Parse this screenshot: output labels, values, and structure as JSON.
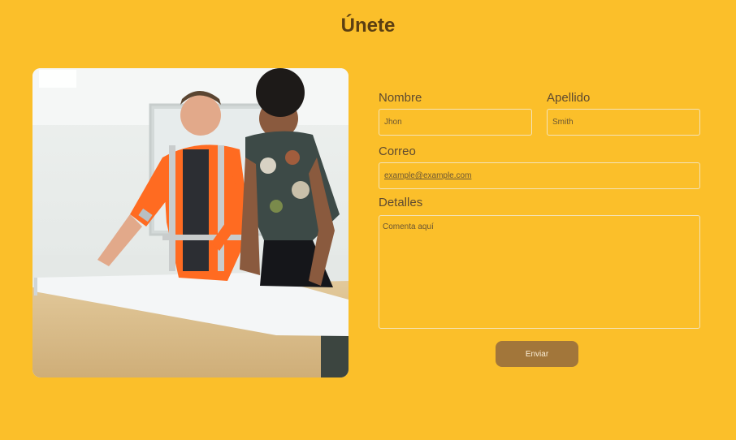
{
  "page": {
    "title": "Únete"
  },
  "form": {
    "first_name": {
      "label": "Nombre",
      "placeholder": "Jhon"
    },
    "last_name": {
      "label": "Apellido",
      "placeholder": "Smith"
    },
    "email": {
      "label": "Correo",
      "placeholder": "example@example.com"
    },
    "details": {
      "label": "Detalles",
      "placeholder": "Comenta aquí"
    },
    "submit_label": "Enviar"
  },
  "colors": {
    "background": "#FBBF2A",
    "button": "#A2763A",
    "title": "#5B3F12"
  }
}
